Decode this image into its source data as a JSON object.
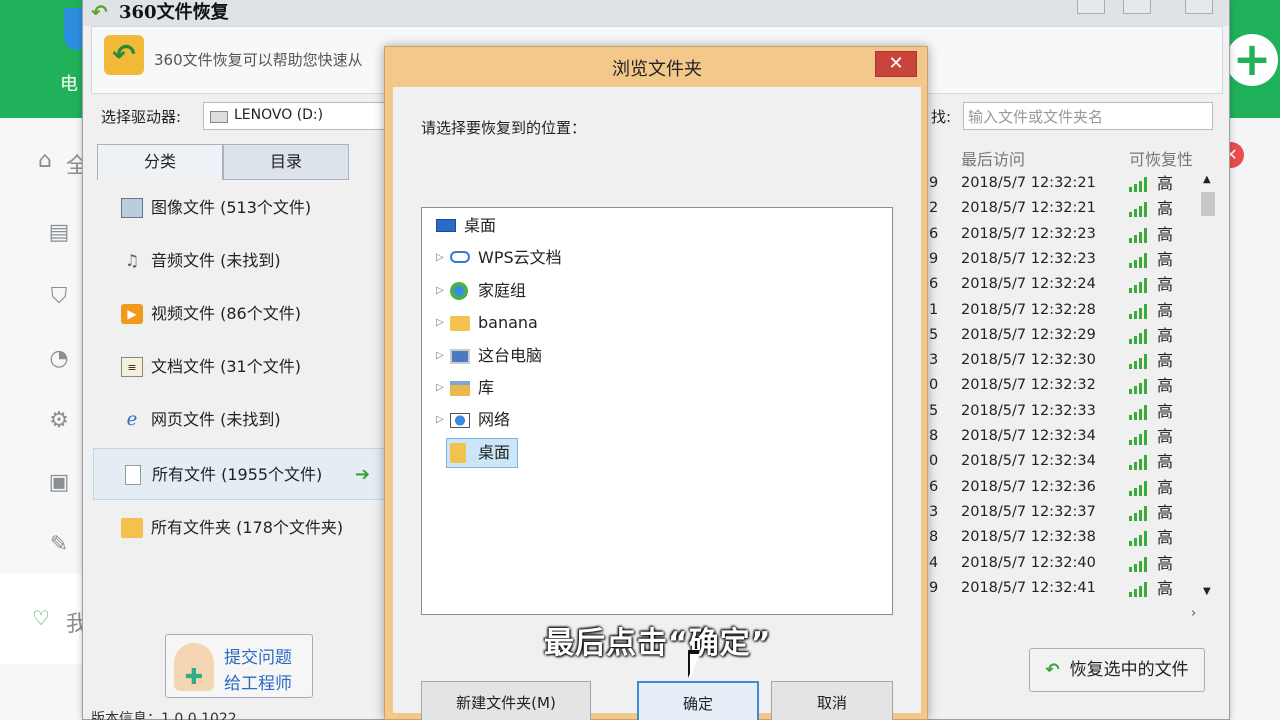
{
  "colors": {
    "brand_green": "#1fb25a",
    "dialog_frame": "#f3c98b",
    "close_red": "#c9443a",
    "signal_green": "#3aaa3a"
  },
  "background_app": {
    "sidebar_text_fragment": "电",
    "side_text_1": "全",
    "side_text_2": "我"
  },
  "window": {
    "title": "360文件恢复",
    "banner_text": "360文件恢复可以帮助您快速从",
    "drive_label": "选择驱动器:",
    "drive_value": "LENOVO (D:)",
    "search_label": "找:",
    "search_placeholder": "输入文件或文件夹名"
  },
  "tabs": {
    "category": "分类",
    "directory": "目录"
  },
  "categories": [
    {
      "label": "图像文件 (513个文件)",
      "icon": "image-icon"
    },
    {
      "label": "音频文件 (未找到)",
      "icon": "music-icon"
    },
    {
      "label": "视频文件 (86个文件)",
      "icon": "video-icon"
    },
    {
      "label": "文档文件 (31个文件)",
      "icon": "document-icon"
    },
    {
      "label": "网页文件 (未找到)",
      "icon": "web-icon"
    },
    {
      "label": "所有文件 (1955个文件)",
      "icon": "file-icon"
    },
    {
      "label": "所有文件夹 (178个文件夹)",
      "icon": "folder-icon"
    }
  ],
  "help": {
    "line1": "提交问题",
    "line2": "给工程师"
  },
  "version": "版本信息：1.0.0.1022",
  "table": {
    "col_last_access": "最后访问",
    "col_recoverability": "可恢复性",
    "rows": [
      {
        "n": "9",
        "time": "2018/5/7 12:32:21",
        "level": "高"
      },
      {
        "n": "2",
        "time": "2018/5/7 12:32:21",
        "level": "高"
      },
      {
        "n": "6",
        "time": "2018/5/7 12:32:23",
        "level": "高"
      },
      {
        "n": "9",
        "time": "2018/5/7 12:32:23",
        "level": "高"
      },
      {
        "n": "6",
        "time": "2018/5/7 12:32:24",
        "level": "高"
      },
      {
        "n": "1",
        "time": "2018/5/7 12:32:28",
        "level": "高"
      },
      {
        "n": "5",
        "time": "2018/5/7 12:32:29",
        "level": "高"
      },
      {
        "n": "3",
        "time": "2018/5/7 12:32:30",
        "level": "高"
      },
      {
        "n": "0",
        "time": "2018/5/7 12:32:32",
        "level": "高"
      },
      {
        "n": "5",
        "time": "2018/5/7 12:32:33",
        "level": "高"
      },
      {
        "n": "8",
        "time": "2018/5/7 12:32:34",
        "level": "高"
      },
      {
        "n": "0",
        "time": "2018/5/7 12:32:34",
        "level": "高"
      },
      {
        "n": "6",
        "time": "2018/5/7 12:32:36",
        "level": "高"
      },
      {
        "n": "3",
        "time": "2018/5/7 12:32:37",
        "level": "高"
      },
      {
        "n": "8",
        "time": "2018/5/7 12:32:38",
        "level": "高"
      },
      {
        "n": "4",
        "time": "2018/5/7 12:32:40",
        "level": "高"
      },
      {
        "n": "9",
        "time": "2018/5/7 12:32:41",
        "level": "高"
      }
    ]
  },
  "restore_button": "恢复选中的文件",
  "dialog": {
    "title": "浏览文件夹",
    "close": "✕",
    "prompt": "请选择要恢复到的位置：",
    "tree": [
      {
        "label": "桌面",
        "icon": "desktop-icon",
        "expander": false,
        "indent": 0
      },
      {
        "label": "WPS云文档",
        "icon": "cloud-icon",
        "expander": true,
        "indent": 1
      },
      {
        "label": "家庭组",
        "icon": "homegroup-icon",
        "expander": true,
        "indent": 1
      },
      {
        "label": "banana",
        "icon": "user-folder-icon",
        "expander": true,
        "indent": 1
      },
      {
        "label": "这台电脑",
        "icon": "computer-icon",
        "expander": true,
        "indent": 1
      },
      {
        "label": "库",
        "icon": "library-icon",
        "expander": true,
        "indent": 1
      },
      {
        "label": "网络",
        "icon": "network-icon",
        "expander": true,
        "indent": 1
      },
      {
        "label": "桌面",
        "icon": "folder-icon",
        "expander": false,
        "indent": 1
      }
    ],
    "btn_new": "新建文件夹(M)",
    "btn_ok": "确定",
    "btn_cancel": "取消"
  },
  "caption": "最后点击“确定”"
}
